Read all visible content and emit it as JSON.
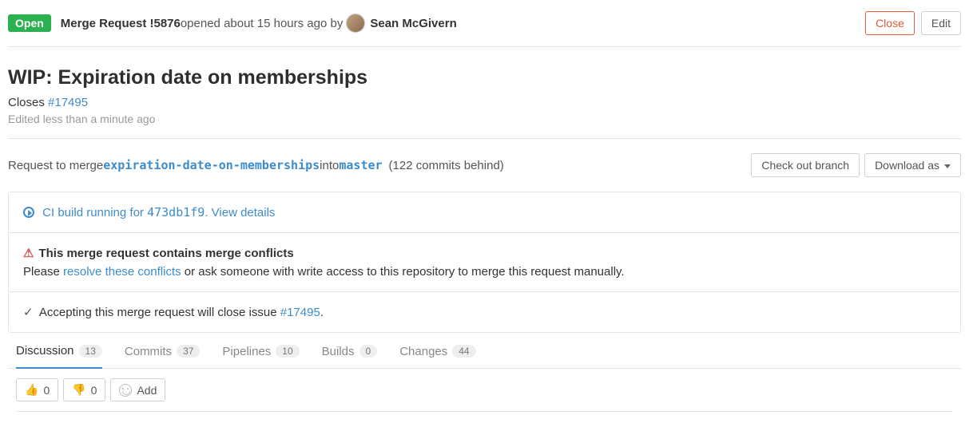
{
  "header": {
    "status": "Open",
    "mr_label": "Merge Request !5876",
    "meta": " opened about 15 hours ago by ",
    "author": "Sean McGivern",
    "close_btn": "Close",
    "edit_btn": "Edit"
  },
  "title_block": {
    "title": "WIP: Expiration date on memberships",
    "closes_prefix": "Closes ",
    "closes_issue": "#17495",
    "edited": "Edited less than a minute ago"
  },
  "merge": {
    "request_prefix": "Request to merge  ",
    "source_branch": "expiration-date-on-memberships",
    "into": "  into  ",
    "target_branch": "master",
    "behind": "(122 commits behind)",
    "checkout_btn": "Check out branch",
    "download_btn": "Download as"
  },
  "ci": {
    "text_prefix": "CI build running for ",
    "hash": "473db1f9",
    "text_suffix": ". View details"
  },
  "conflict": {
    "title": "This merge request contains merge conflicts",
    "please": "Please ",
    "resolve_link": "resolve these conflicts",
    "suffix": " or ask someone with write access to this repository to merge this request manually."
  },
  "closing": {
    "prefix": "Accepting this merge request will close issue ",
    "issue": "#17495",
    "suffix": "."
  },
  "tabs": {
    "discussion": {
      "label": "Discussion",
      "count": "13"
    },
    "commits": {
      "label": "Commits",
      "count": "37"
    },
    "pipelines": {
      "label": "Pipelines",
      "count": "10"
    },
    "builds": {
      "label": "Builds",
      "count": "0"
    },
    "changes": {
      "label": "Changes",
      "count": "44"
    }
  },
  "reactions": {
    "thumbs_up": "0",
    "thumbs_down": "0",
    "add": "Add"
  }
}
